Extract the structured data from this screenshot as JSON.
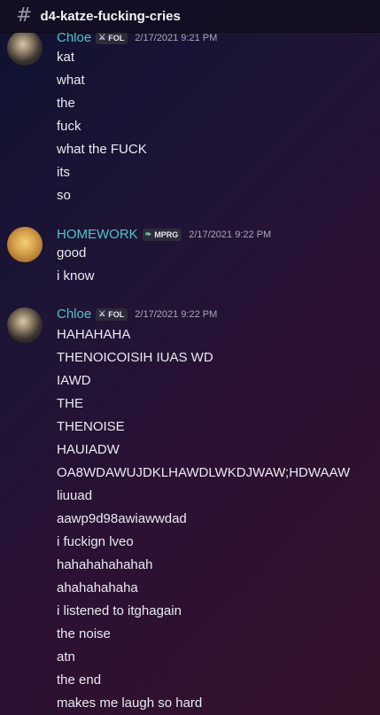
{
  "channel": {
    "name": "d4-katze-fucking-cries",
    "icon": "hash-icon"
  },
  "groups": [
    {
      "author": "Chloe",
      "tag": "FOL",
      "tag_icon": "sword-icon",
      "timestamp": "2/17/2021 9:21 PM",
      "lines": [
        "kat",
        "what",
        "the",
        "fuck",
        "what the FUCK",
        "its",
        "so"
      ]
    },
    {
      "author": "HOMEWORK",
      "tag": "MPRG",
      "tag_icon": "leaf-icon",
      "timestamp": "2/17/2021 9:22 PM",
      "lines": [
        "good",
        "i know"
      ]
    },
    {
      "author": "Chloe",
      "tag": "FOL",
      "tag_icon": "sword-icon",
      "timestamp": "2/17/2021 9:22 PM",
      "lines": [
        "HAHAHAHA",
        "THENOICOISIH IUAS WD",
        "IAWD",
        "THE",
        "THENOISE",
        "HAUIADW",
        "OA8WDAWUJDKLHAWDLWKDJWAW;HDWAAW",
        "liuuad",
        "aawp9d98awiawwdad",
        "i fuckign lveo",
        "hahahahahahah",
        "ahahahahaha",
        "i listened to itghagain",
        "the noise",
        "atn",
        "the end",
        "makes me laugh so hard"
      ]
    }
  ],
  "colors": {
    "author": "#4fc3c8",
    "header_bg": "#140e22",
    "text": "#ebe9f2",
    "timestamp": "#a9a6b6"
  }
}
